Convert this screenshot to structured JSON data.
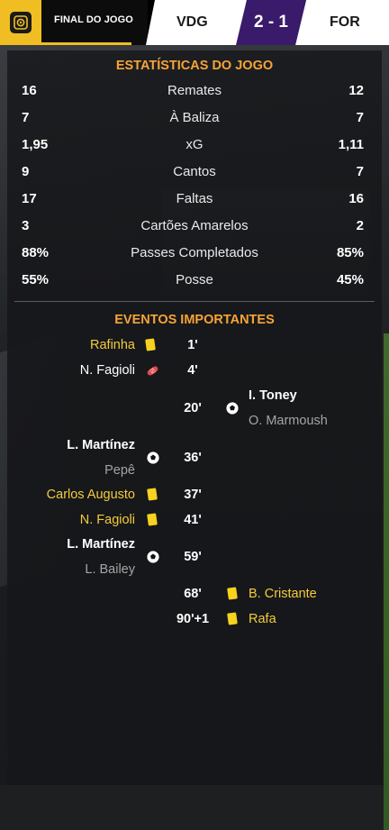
{
  "header": {
    "status": "FINAL DO JOGO",
    "home_team": "VDG",
    "away_team": "FOR",
    "score": "2 - 1",
    "logo_icon": "competition-badge-icon"
  },
  "colors": {
    "accent": "#f0be22",
    "section_title": "#f7a437",
    "score_bg": "#3a1a6b",
    "yellow_card": "#f7d21e",
    "red_injury": "#e6464b"
  },
  "stats_title": "ESTATÍSTICAS DO JOGO",
  "stats": [
    {
      "home": "16",
      "name": "Remates",
      "away": "12"
    },
    {
      "home": "7",
      "name": "À Baliza",
      "away": "7"
    },
    {
      "home": "1,95",
      "name": "xG",
      "away": "1,11"
    },
    {
      "home": "9",
      "name": "Cantos",
      "away": "7"
    },
    {
      "home": "17",
      "name": "Faltas",
      "away": "16"
    },
    {
      "home": "3",
      "name": "Cartões Amarelos",
      "away": "2"
    },
    {
      "home": "88%",
      "name": "Passes Completados",
      "away": "85%"
    },
    {
      "home": "55%",
      "name": "Posse",
      "away": "45%"
    }
  ],
  "events_title": "EVENTOS IMPORTANTES",
  "events": {
    "e1": {
      "player": "Rafinha",
      "minute": "1'",
      "icon": "yellow-card-icon"
    },
    "e2": {
      "player": "N. Fagioli",
      "minute": "4'",
      "icon": "injury-icon"
    },
    "e3": {
      "player": "I. Toney",
      "assist": "O. Marmoush",
      "minute": "20'",
      "icon": "goal-ball-icon"
    },
    "e4": {
      "player": "L. Martínez",
      "assist": "Pepê",
      "minute": "36'",
      "icon": "goal-ball-icon"
    },
    "e5": {
      "player": "Carlos Augusto",
      "minute": "37'",
      "icon": "yellow-card-icon"
    },
    "e6": {
      "player": "N. Fagioli",
      "minute": "41'",
      "icon": "yellow-card-icon"
    },
    "e7": {
      "player": "L. Martínez",
      "assist": "L. Bailey",
      "minute": "59'",
      "icon": "goal-ball-icon"
    },
    "e8": {
      "player": "B. Cristante",
      "minute": "68'",
      "icon": "yellow-card-icon"
    },
    "e9": {
      "player": "Rafa",
      "minute": "90'+1",
      "icon": "yellow-card-icon"
    }
  }
}
